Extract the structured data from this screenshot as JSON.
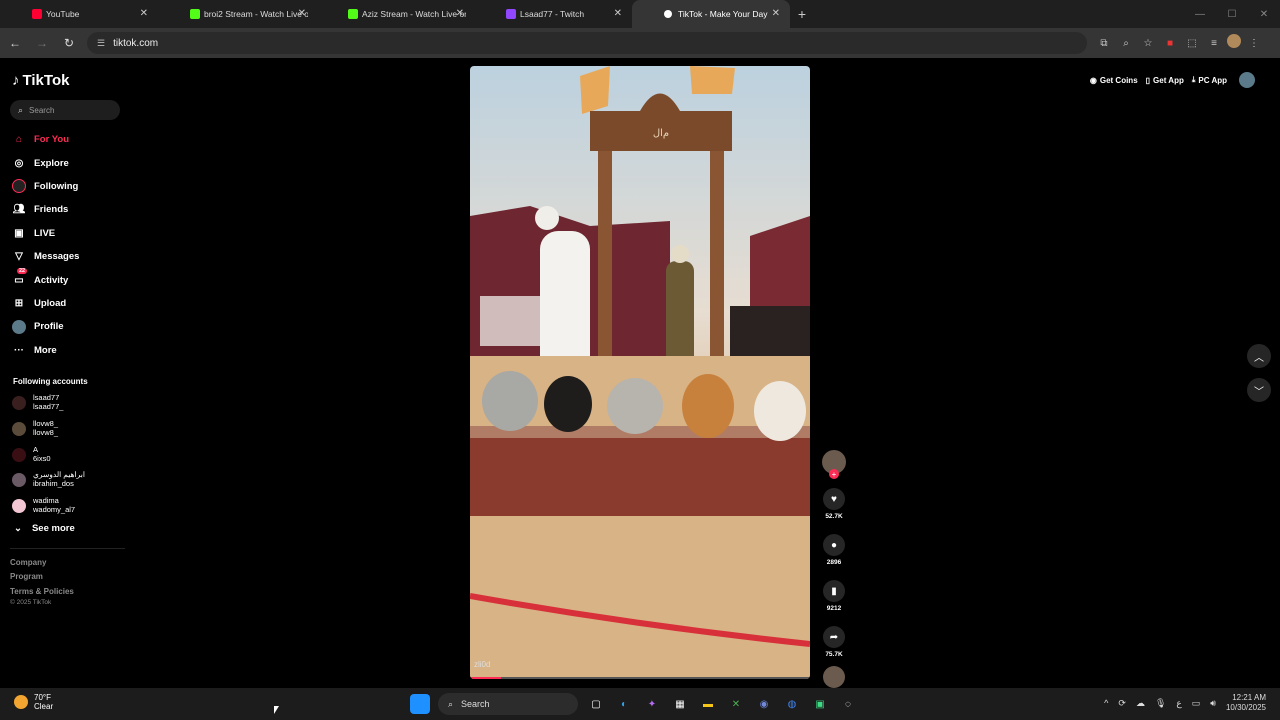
{
  "browser": {
    "tabs": [
      {
        "title": "YouTube",
        "color": "#ff0033"
      },
      {
        "title": "broi2 Stream - Watch Live on K",
        "color": "#53fc18"
      },
      {
        "title": "Aziz Stream - Watch Live on Ki",
        "color": "#53fc18"
      },
      {
        "title": "Lsaad77 - Twitch",
        "color": "#9146ff"
      },
      {
        "title": "TikTok - Make Your Day",
        "color": "#ffffff"
      }
    ],
    "url": "tiktok.com"
  },
  "tiktok": {
    "logo": "TikTok",
    "search_placeholder": "Search",
    "nav": [
      {
        "label": "For You",
        "icon": "home-icon"
      },
      {
        "label": "Explore",
        "icon": "compass-icon"
      },
      {
        "label": "Following",
        "icon": "following-icon"
      },
      {
        "label": "Friends",
        "icon": "friends-icon"
      },
      {
        "label": "LIVE",
        "icon": "live-icon"
      },
      {
        "label": "Messages",
        "icon": "messages-icon"
      },
      {
        "label": "Activity",
        "icon": "activity-icon",
        "badge": "22"
      },
      {
        "label": "Upload",
        "icon": "upload-icon"
      },
      {
        "label": "Profile",
        "icon": "profile-icon"
      },
      {
        "label": "More",
        "icon": "more-icon"
      }
    ],
    "following_header": "Following accounts",
    "accounts": [
      {
        "name": "lsaad77",
        "handle": "lsaad77_"
      },
      {
        "name": "llovw8_",
        "handle": "llovw8_"
      },
      {
        "name": "A",
        "handle": "6ixs0"
      },
      {
        "name": "ابراهيم الدوسري",
        "handle": "ibrahim_dos"
      },
      {
        "name": "wadima",
        "handle": "wadomy_al7"
      }
    ],
    "see_more": "See more",
    "footer": [
      "Company",
      "Program",
      "Terms & Policies"
    ],
    "copyright": "© 2025 TikTok",
    "top_buttons": [
      "Get Coins",
      "Get App",
      "PC App"
    ],
    "video_tag": "zli0d",
    "video_progress": 0.09,
    "actions": {
      "likes": "52.7K",
      "comments": "2896",
      "saves": "9212",
      "shares": "75.7K"
    }
  },
  "taskbar": {
    "temp": "70°F",
    "condition": "Clear",
    "search": "Search",
    "time": "12:21 AM",
    "date": "10/30/2025"
  }
}
